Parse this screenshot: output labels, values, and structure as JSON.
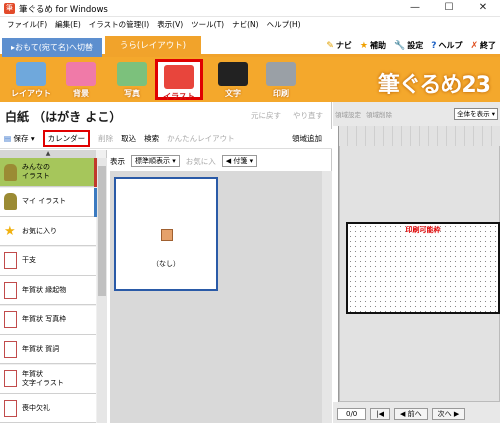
{
  "window": {
    "title": "筆ぐるめ for Windows",
    "minimize": "—",
    "maximize": "☐",
    "close": "✕"
  },
  "menu": [
    "ファイル(F)",
    "編集(E)",
    "イラストの管理(I)",
    "表示(V)",
    "ツール(T)",
    "ナビ(N)",
    "ヘルプ(H)"
  ],
  "tabs": {
    "front": "▸おもて(宛て名)へ切替",
    "back": "うら(レイアウト)"
  },
  "top_tools": [
    {
      "icon": "pointer-icon",
      "glyph": "✎",
      "label": "ナビ",
      "color": "#e0a000"
    },
    {
      "icon": "star-icon",
      "glyph": "★",
      "label": "補助",
      "color": "#f0a000"
    },
    {
      "icon": "wrench-icon",
      "glyph": "🔧",
      "label": "設定",
      "color": "#555555"
    },
    {
      "icon": "help-icon",
      "glyph": "?",
      "label": "ヘルプ",
      "color": "#1a5fc4"
    },
    {
      "icon": "exit-icon",
      "glyph": "✗",
      "label": "終了",
      "color": "#e05020"
    }
  ],
  "toolbar": {
    "items": [
      {
        "label": "レイアウト",
        "icon": "layout-icon",
        "color": "#6fa8dc"
      },
      {
        "label": "背景",
        "icon": "background-icon",
        "color": "#f07aa8"
      },
      {
        "label": "写真",
        "icon": "photo-icon",
        "color": "#7cc17c"
      },
      {
        "label": "イラスト",
        "icon": "illust-icon",
        "color": "#e8453c"
      },
      {
        "label": "文字",
        "icon": "text-icon",
        "color": "#222222"
      },
      {
        "label": "印刷",
        "icon": "print-icon",
        "color": "#9aa0a6"
      }
    ],
    "active_index": 3,
    "brand": "筆ぐるめ23"
  },
  "left": {
    "doc_title": "白紙 （はがき よこ）",
    "undo": "元に戻す",
    "redo": "やり直す",
    "subbar": {
      "save": "保存",
      "calendar": "カレンダー",
      "delete": "削除",
      "import": "取込",
      "search": "検索",
      "easy_layout": "かんたんレイアウト",
      "add_area": "領域追加"
    },
    "categories": [
      {
        "label": "みんなの\nイラスト",
        "icon": "person-icon",
        "active": true,
        "bar": "#c0392b"
      },
      {
        "label": "マイ イラスト",
        "icon": "person-icon",
        "active": false,
        "bar": "#3b7ac0"
      },
      {
        "label": "お気に入り",
        "icon": "star-icon",
        "active": false,
        "bar": ""
      },
      {
        "label": "干支",
        "icon": "card-icon",
        "active": false,
        "bar": ""
      },
      {
        "label": "年賀状 縁起物",
        "icon": "card-icon",
        "active": false,
        "bar": ""
      },
      {
        "label": "年賀状 写真枠",
        "icon": "card-icon",
        "active": false,
        "bar": ""
      },
      {
        "label": "年賀状 賀詞",
        "icon": "card-icon",
        "active": false,
        "bar": ""
      },
      {
        "label": "年賀状\n文字イラスト",
        "icon": "card-icon",
        "active": false,
        "bar": ""
      },
      {
        "label": "喪中欠礼",
        "icon": "card-icon",
        "active": false,
        "bar": ""
      }
    ],
    "display": {
      "label": "表示",
      "sort": "標準順表示",
      "favorite": "お気に入",
      "tag": "付箋"
    },
    "thumbnail_label": "（なし）"
  },
  "right": {
    "toolbar": [
      "領域設定",
      "領域削除"
    ],
    "zoom": "全体を表示",
    "page_text": "印刷可能枠",
    "page_counter": "0/0",
    "prev": "前へ",
    "next": "次へ"
  }
}
